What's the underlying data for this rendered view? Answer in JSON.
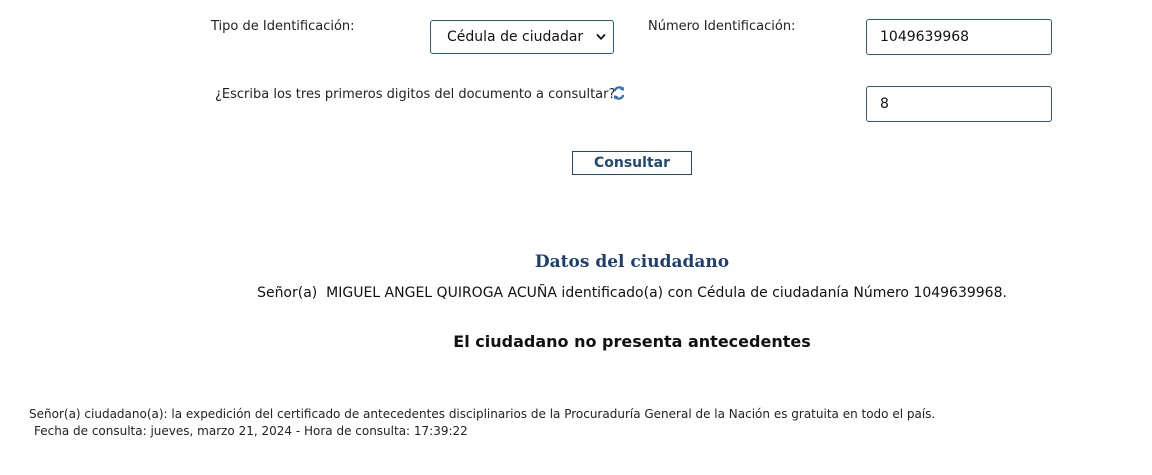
{
  "form": {
    "id_type_label": "Tipo de Identificación:",
    "id_type_selected": "Cédula de ciudadar",
    "id_number_label": "Número Identificación:",
    "id_number_value": "1049639968",
    "captcha_label": "¿Escriba los tres primeros digitos del documento a consultar?",
    "captcha_value": "8",
    "submit_label": "Consultar"
  },
  "result": {
    "title": "Datos del ciudadano",
    "citizen_text": "Señor(a)  MIGUEL ANGEL QUIROGA ACUÑA identificado(a) con Cédula de ciudadanía Número 1049639968.",
    "status_text": "El ciudadano no presenta antecedentes"
  },
  "footer": {
    "note": "Señor(a) ciudadano(a): la expedición del certificado de antecedentes disciplinarios de la Procuraduría General de la Nación es gratuita en todo el país.",
    "consult_date": "Fecha de consulta: jueves, marzo 21, 2024 - Hora de consulta: 17:39:22"
  },
  "icons": {
    "refresh": "refresh-icon",
    "dropdown": "chevron-down-icon"
  },
  "colors": {
    "accent": "#1f3f73",
    "border": "#2b5a8a",
    "refresh_icon": "#2e6fbf"
  }
}
